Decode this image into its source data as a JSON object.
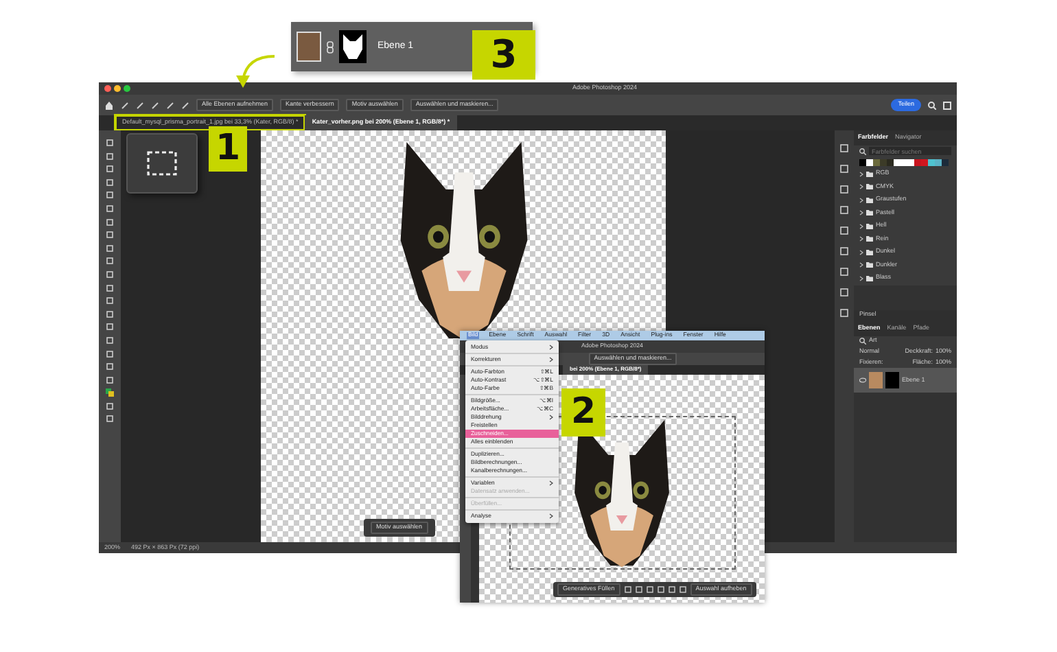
{
  "main_window": {
    "title": "Adobe Photoshop 2024",
    "options": [
      "Alle Ebenen aufnehmen",
      "Kante verbessern",
      "Motiv auswählen",
      "Auswählen und maskieren..."
    ],
    "share_button": "Teilen",
    "tabs": [
      {
        "label": "Default_mysql_prisma_portrait_1.jpg bei 33,3% (Kater, RGB/8) *",
        "selected": false,
        "highlighted": true
      },
      {
        "label": "Kater_vorher.png bei 200% (Ebene 1, RGB/8*) *",
        "selected": true,
        "highlighted": false
      }
    ],
    "context_bar": [
      "Motiv auswählen"
    ],
    "status": {
      "zoom": "200%",
      "size": "492 Px × 863 Px (72 ppi)"
    },
    "swatches_panel": {
      "tabs": [
        {
          "label": "Farbfelder",
          "selected": true
        },
        {
          "label": "Navigator",
          "selected": false
        }
      ],
      "placeholder": "Farbfelder suchen",
      "swatches": [
        {
          "color": "#000000"
        },
        {
          "color": "#ffffff"
        },
        {
          "color": "#6b6a3c"
        },
        {
          "color": "#3c3b28"
        },
        {
          "color": "#2b2a1f"
        },
        {
          "color": "#ffffff"
        },
        {
          "color": "#ffffff"
        },
        {
          "color": "#ffffff"
        },
        {
          "color": "#c8141e"
        },
        {
          "color": "#d0161f"
        },
        {
          "color": "#4fc3d0"
        },
        {
          "color": "#5ab3c6"
        },
        {
          "color": "#1c2b3a"
        }
      ],
      "folders": [
        "RGB",
        "CMYK",
        "Graustufen",
        "Pastell",
        "Hell",
        "Rein",
        "Dunkel",
        "Dunkler",
        "Blass"
      ]
    },
    "layers_panel": {
      "header": "Pinsel",
      "tabs": [
        {
          "label": "Ebenen",
          "selected": true
        },
        {
          "label": "Kanäle",
          "selected": false
        },
        {
          "label": "Pfade",
          "selected": false
        }
      ],
      "filter": "Art",
      "blend_mode": "Normal",
      "opacity_label": "Deckkraft:",
      "opacity": "100%",
      "lock_label": "Fixieren:",
      "fill_label": "Fläche:",
      "fill": "100%",
      "layers": [
        {
          "name": "Ebene 1",
          "selected": true
        }
      ]
    }
  },
  "callouts": [
    "1",
    "2",
    "3"
  ],
  "layer_callout": {
    "name": "Ebene 1"
  },
  "inset_window": {
    "menu_bar": [
      {
        "label": "Bild",
        "selected": true
      },
      {
        "label": "Ebene",
        "selected": false
      },
      {
        "label": "Schrift",
        "selected": false
      },
      {
        "label": "Auswahl",
        "selected": false
      },
      {
        "label": "Filter",
        "selected": false
      },
      {
        "label": "3D",
        "selected": false
      },
      {
        "label": "Ansicht",
        "selected": false
      },
      {
        "label": "Plug-ins",
        "selected": false
      },
      {
        "label": "Fenster",
        "selected": false
      },
      {
        "label": "Hilfe",
        "selected": false
      }
    ],
    "title": "Adobe Photoshop 2024",
    "option_button": "Auswählen und maskieren...",
    "tab": "bei 200% (Ebene 1, RGB/8*)",
    "menu_groups": [
      [
        {
          "label": "Modus",
          "kind": "submenu",
          "selected": false,
          "disabled": false
        }
      ],
      [
        {
          "label": "Korrekturen",
          "kind": "submenu",
          "selected": false,
          "disabled": false
        }
      ],
      [
        {
          "label": "Auto-Farbton",
          "kind": "command",
          "shortcut": "⇧⌘L",
          "selected": false,
          "disabled": false
        },
        {
          "label": "Auto-Kontrast",
          "kind": "command",
          "shortcut": "⌥⇧⌘L",
          "selected": false,
          "disabled": false
        },
        {
          "label": "Auto-Farbe",
          "kind": "command",
          "shortcut": "⇧⌘B",
          "selected": false,
          "disabled": false
        }
      ],
      [
        {
          "label": "Bildgröße...",
          "kind": "command",
          "shortcut": "⌥⌘I",
          "selected": false,
          "disabled": false
        },
        {
          "label": "Arbeitsfläche...",
          "kind": "command",
          "shortcut": "⌥⌘C",
          "selected": false,
          "disabled": false
        },
        {
          "label": "Bilddrehung",
          "kind": "submenu",
          "selected": false,
          "disabled": false
        },
        {
          "label": "Freistellen",
          "kind": "command",
          "selected": false,
          "disabled": false
        },
        {
          "label": "Zuschneiden...",
          "kind": "command",
          "selected": true,
          "disabled": false
        },
        {
          "label": "Alles einblenden",
          "kind": "command",
          "selected": false,
          "disabled": false
        }
      ],
      [
        {
          "label": "Duplizieren...",
          "kind": "command",
          "selected": false,
          "disabled": false
        },
        {
          "label": "Bildberechnungen...",
          "kind": "command",
          "selected": false,
          "disabled": false
        },
        {
          "label": "Kanalberechnungen...",
          "kind": "command",
          "selected": false,
          "disabled": false
        }
      ],
      [
        {
          "label": "Variablen",
          "kind": "submenu",
          "selected": false,
          "disabled": false
        },
        {
          "label": "Datensatz anwenden...",
          "kind": "command",
          "selected": false,
          "disabled": true
        }
      ],
      [
        {
          "label": "Überfüllen...",
          "kind": "command",
          "selected": false,
          "disabled": true
        }
      ],
      [
        {
          "label": "Analyse",
          "kind": "submenu",
          "selected": false,
          "disabled": false
        }
      ]
    ],
    "context_bar": {
      "first": "Generatives Füllen",
      "last": "Auswahl aufheben"
    }
  }
}
